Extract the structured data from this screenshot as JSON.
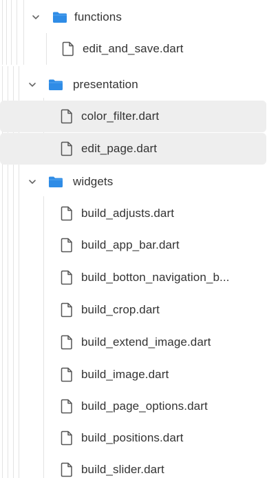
{
  "tree": {
    "items": [
      {
        "kind": "folder",
        "name": "functions",
        "expanded": true,
        "icon": "folder-icon"
      },
      {
        "kind": "file",
        "name": "edit_and_save.dart",
        "icon": "file-icon"
      },
      {
        "kind": "folder",
        "name": "presentation",
        "expanded": true,
        "icon": "folder-icon"
      },
      {
        "kind": "file",
        "name": "color_filter.dart",
        "icon": "file-icon",
        "selected": true
      },
      {
        "kind": "file",
        "name": "edit_page.dart",
        "icon": "file-icon",
        "selected": true
      },
      {
        "kind": "folder",
        "name": "widgets",
        "expanded": true,
        "icon": "folder-icon"
      },
      {
        "kind": "file",
        "name": "build_adjusts.dart",
        "icon": "file-icon"
      },
      {
        "kind": "file",
        "name": "build_app_bar.dart",
        "icon": "file-icon"
      },
      {
        "kind": "file",
        "name": "build_botton_navigation_b...",
        "icon": "file-icon"
      },
      {
        "kind": "file",
        "name": "build_crop.dart",
        "icon": "file-icon"
      },
      {
        "kind": "file",
        "name": "build_extend_image.dart",
        "icon": "file-icon"
      },
      {
        "kind": "file",
        "name": "build_image.dart",
        "icon": "file-icon"
      },
      {
        "kind": "file",
        "name": "build_page_options.dart",
        "icon": "file-icon"
      },
      {
        "kind": "file",
        "name": "build_positions.dart",
        "icon": "file-icon"
      },
      {
        "kind": "file",
        "name": "build_slider.dart",
        "icon": "file-icon"
      }
    ]
  },
  "colors": {
    "folder": "#2f8ce6",
    "selected_bg": "#eeeeee",
    "guide": "#e3e3e3",
    "text": "#333333"
  }
}
